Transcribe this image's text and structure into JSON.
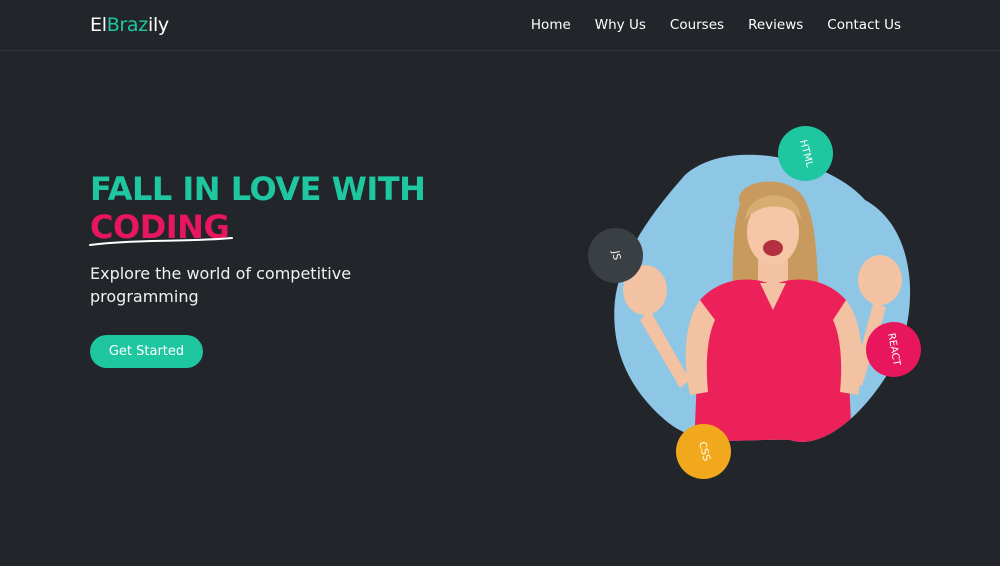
{
  "brand": {
    "logo_part1": "El",
    "logo_part2": "Braz",
    "logo_part3": "i",
    "logo_part4": "ly"
  },
  "nav": [
    "Home",
    "Why Us",
    "Courses",
    "Reviews",
    "Contact Us"
  ],
  "hero": {
    "title_line1": "FALL IN LOVE WITH",
    "title_line2": "CODING",
    "subtitle": "Explore the world of competitive programming",
    "cta_label": "Get Started"
  },
  "badges": {
    "html": "HTML",
    "js": "JS",
    "react": "REACT",
    "css": "CSS"
  },
  "colors": {
    "background": "#22262a",
    "teal": "#1fc7a0",
    "pink": "#e8165d",
    "blob": "#8ec6e6",
    "orange": "#f2a81d",
    "dark_badge": "#3a3f44"
  },
  "icons": [
    "woman-photo"
  ]
}
